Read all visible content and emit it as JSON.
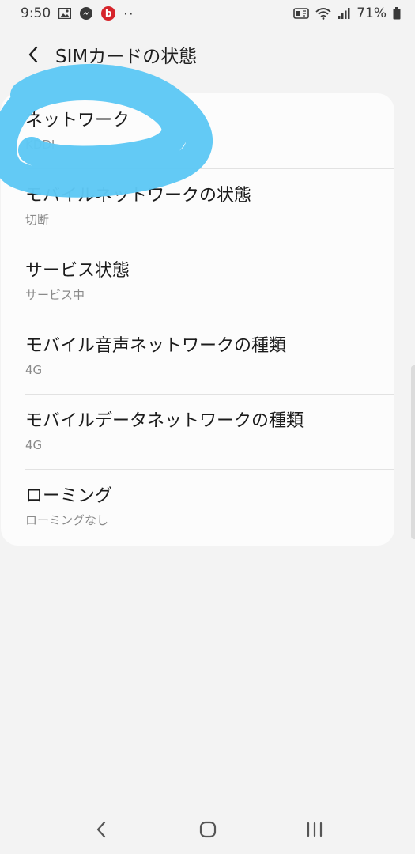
{
  "status_bar": {
    "time": "9:50",
    "battery_percent": "71%",
    "beats_label": "b",
    "more_dots": "··"
  },
  "header": {
    "title": "SIMカードの状態"
  },
  "items": [
    {
      "title": "ネットワーク",
      "subtitle": "KDDI"
    },
    {
      "title": "モバイルネットワークの状態",
      "subtitle": "切断"
    },
    {
      "title": "サービス状態",
      "subtitle": "サービス中"
    },
    {
      "title": "モバイル音声ネットワークの種類",
      "subtitle": "4G"
    },
    {
      "title": "モバイルデータネットワークの種類",
      "subtitle": "4G"
    },
    {
      "title": "ローミング",
      "subtitle": "ローミングなし"
    }
  ],
  "colors": {
    "scribble": "#5ec8f5",
    "background": "#f3f3f3",
    "card": "#fcfcfc"
  },
  "icons": {
    "status_left": [
      "gallery-icon",
      "messenger-icon",
      "beats-icon",
      "more-dots-icon"
    ],
    "status_right": [
      "nfc-icon",
      "wifi-icon",
      "signal-icon",
      "battery-icon"
    ],
    "header": [
      "back-arrow-icon"
    ],
    "nav": [
      "nav-back-icon",
      "nav-home-icon",
      "nav-recents-icon"
    ]
  }
}
